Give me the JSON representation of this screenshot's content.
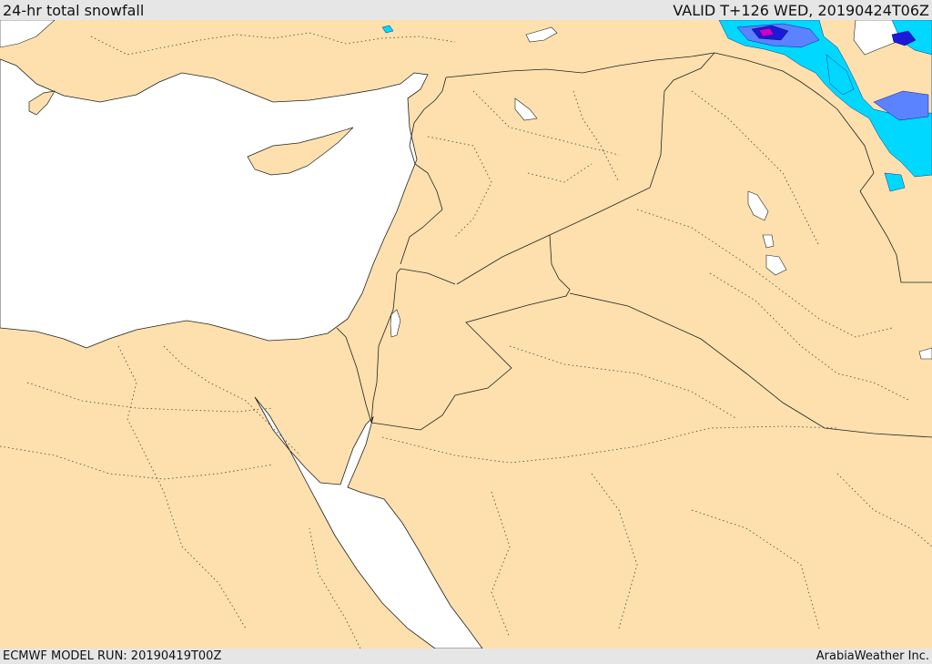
{
  "header": {
    "title": "24-hr total snowfall",
    "valid": "VALID T+126 WED, 20190424T06Z"
  },
  "footer": {
    "model_run": "ECMWF MODEL RUN: 20190419T00Z",
    "credit": "ArabiaWeather Inc."
  },
  "map": {
    "land_color": "#fde0ad",
    "water_color": "#ffffff",
    "border_color": "#222222",
    "snow_colors": [
      "#00d8ff",
      "#5b82ff",
      "#1a1ad8",
      "#cc00cc"
    ]
  }
}
